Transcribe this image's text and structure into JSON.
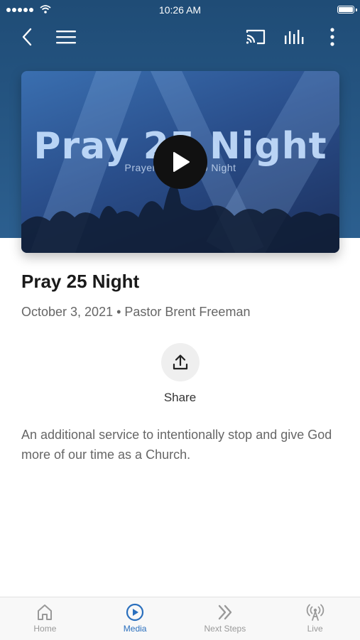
{
  "status_bar": {
    "time": "10:26 AM"
  },
  "hero": {
    "title_text": "Pray 25 Night",
    "subtitle_text": "Prayer & Worship Night"
  },
  "sermon": {
    "title": "Pray 25 Night",
    "meta": "October 3, 2021 • Pastor Brent Freeman",
    "share_label": "Share",
    "description": "An additional service to intentionally stop and give God more of our time as a Church."
  },
  "tabs": [
    {
      "label": "Home",
      "icon": "home-icon"
    },
    {
      "label": "Media",
      "icon": "play-circle-icon",
      "active": true
    },
    {
      "label": "Next Steps",
      "icon": "double-chevron-right-icon"
    },
    {
      "label": "Live",
      "icon": "broadcast-icon"
    }
  ],
  "colors": {
    "header": "#2c5f8f",
    "accent": "#2a6fbd",
    "inactive_tab": "#999999"
  }
}
